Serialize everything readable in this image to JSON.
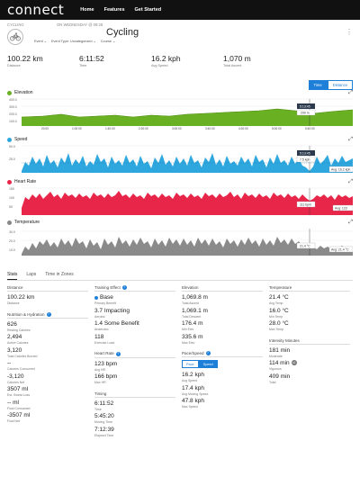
{
  "nav": {
    "logo": "connect",
    "links": [
      "Home",
      "Features",
      "Get Started"
    ]
  },
  "activity": {
    "category": "CYCLING",
    "date": "ON WEDNESDAY @ 09:28",
    "title": "Cycling",
    "sub": [
      "Event ⌄",
      "Event Type: Uncategorized ⌄",
      "Course ⌄"
    ]
  },
  "summary": [
    {
      "value": "100.22 km",
      "label": "Distance"
    },
    {
      "value": "6:11:52",
      "label": "Time"
    },
    {
      "value": "16.2 kph",
      "label": "Avg Speed"
    },
    {
      "value": "1,070 m",
      "label": "Total Ascent"
    }
  ],
  "toggle": {
    "time": "Time",
    "distance": "Distance"
  },
  "x_ticks": [
    "20:00",
    "1:00:00",
    "1:40:00",
    "2:20:00",
    "3:00:00",
    "3:40:00",
    "4:20:00",
    "5:00:00",
    "5:40:00"
  ],
  "charts": {
    "elevation": {
      "title": "Elevation",
      "color": "#6ab023",
      "yticks": [
        "400.0",
        "300.0",
        "200.0",
        "100.0"
      ],
      "tooltip_time": "5:13:45",
      "tooltip_value": "290 m"
    },
    "speed": {
      "title": "Speed",
      "color": "#2ea7df",
      "yticks": [
        "50.0",
        "25.0"
      ],
      "tooltip_time": "5:13:45",
      "tooltip_value": "7.5 kph",
      "avg_label": "Avg: 16.2 kph"
    },
    "heart_rate": {
      "title": "Heart Rate",
      "color": "#e8264a",
      "yticks": [
        "150",
        "100",
        "50"
      ],
      "tooltip_value": "111 bpm",
      "avg_label": "Avg: 123"
    },
    "temperature": {
      "title": "Temperature",
      "color": "#888888",
      "yticks": [
        "30.0",
        "20.0",
        "10.0"
      ],
      "tooltip_value": "21.4 °C",
      "avg_label": "Avg: 21.4 °C"
    }
  },
  "tabs": [
    "Stats",
    "Laps",
    "Time in Zones"
  ],
  "col1": {
    "distance_head": "Distance",
    "distance": {
      "value": "100.22 km",
      "label": "Distance"
    },
    "nutrition_head": "Nutrition & Hydration",
    "items": [
      {
        "value": "626",
        "label": "Resting Calories"
      },
      {
        "value": "2,494",
        "label": "Active Calories"
      },
      {
        "value": "3,120",
        "label": "Total Calories Burned"
      },
      {
        "value": "--",
        "label": "Calories Consumed"
      },
      {
        "value": "-3,120",
        "label": "Calories Net"
      },
      {
        "value": "3507 ml",
        "label": "Est. Sweat Loss"
      },
      {
        "value": "-- ml",
        "label": "Fluid Consumed"
      },
      {
        "value": "-3507 ml",
        "label": "Fluid Net"
      }
    ]
  },
  "col2": {
    "te_head": "Training Effect",
    "te_items": [
      {
        "value": "Base",
        "label": "Primary Benefit"
      },
      {
        "value": "3.7 Impacting",
        "label": "Aerobic"
      },
      {
        "value": "1.4 Some Benefit",
        "label": "Anaerobic"
      },
      {
        "value": "118",
        "label": "Exercise Load"
      }
    ],
    "hr_head": "Heart Rate",
    "hr_items": [
      {
        "value": "123 bpm",
        "label": "Avg HR"
      },
      {
        "value": "166 bpm",
        "label": "Max HR"
      }
    ],
    "timing_head": "Timing",
    "timing_items": [
      {
        "value": "6:11:52",
        "label": "Time"
      },
      {
        "value": "5:45:20",
        "label": "Moving Time"
      },
      {
        "value": "7:12:39",
        "label": "Elapsed Time"
      }
    ]
  },
  "col3": {
    "elev_head": "Elevation",
    "elev_items": [
      {
        "value": "1,069.8 m",
        "label": "Total Ascent"
      },
      {
        "value": "1,069.1 m",
        "label": "Total Descent"
      },
      {
        "value": "176.4 m",
        "label": "Min Elev"
      },
      {
        "value": "335.6 m",
        "label": "Max Elev"
      }
    ],
    "pace_head": "Pace/Speed",
    "pace_btn": "Pace",
    "speed_btn": "Speed",
    "speed_items": [
      {
        "value": "16.2 kph",
        "label": "Avg Speed"
      },
      {
        "value": "17.4 kph",
        "label": "Avg Moving Speed"
      },
      {
        "value": "47.8 kph",
        "label": "Max Speed"
      }
    ]
  },
  "col4": {
    "temp_head": "Temperature",
    "temp_items": [
      {
        "value": "21.4 °C",
        "label": "Avg Temp"
      },
      {
        "value": "16.0 °C",
        "label": "Min Temp"
      },
      {
        "value": "28.0 °C",
        "label": "Max Temp"
      }
    ],
    "im_head": "Intensity Minutes",
    "im_items": [
      {
        "value": "181 min",
        "label": "Moderate"
      },
      {
        "value": "114 min",
        "label": "Vigorous",
        "badge": "x2"
      },
      {
        "value": "409 min",
        "label": "Total"
      }
    ]
  }
}
